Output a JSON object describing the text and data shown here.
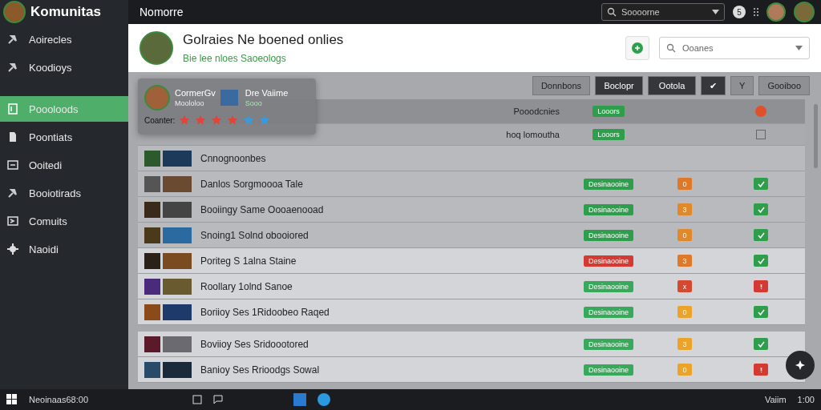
{
  "app": {
    "name": "Komunitas"
  },
  "sidebar": {
    "items": [
      {
        "label": "Aoirecles",
        "selected": false
      },
      {
        "label": "Koodioys",
        "selected": false
      },
      {
        "label": "Poooloods",
        "selected": true
      },
      {
        "label": "Poontiats",
        "selected": false
      },
      {
        "label": "Ooitedi",
        "selected": false
      },
      {
        "label": "Booiotirads",
        "selected": false
      },
      {
        "label": "Comuits",
        "selected": false
      },
      {
        "label": "Naoidi",
        "selected": false
      }
    ]
  },
  "topbar": {
    "title": "Nomorre",
    "search": {
      "placeholder": "Soooorne"
    },
    "badge": "5"
  },
  "header": {
    "title": "Golraies Ne boened onlies",
    "subtitle": "Bie lee nloes Saoeologs",
    "search": {
      "placeholder": "Ooanes"
    }
  },
  "toolbar": {
    "buttons": [
      {
        "label": "Donnbons",
        "kind": "text",
        "selected": false
      },
      {
        "label": "Boclopr",
        "kind": "text",
        "selected": true
      },
      {
        "label": "Ootola",
        "kind": "text",
        "selected": true
      },
      {
        "label": "✔",
        "kind": "text",
        "selected": true
      },
      {
        "label": "Y",
        "kind": "text",
        "selected": false
      },
      {
        "label": "Gooiboo",
        "kind": "text",
        "selected": false
      }
    ]
  },
  "popup": {
    "name": "CormerGv",
    "handle": "Moololoo",
    "game": "Dre Vaiime",
    "game_sub": "Sooo",
    "rating_label": "Coanter:",
    "stars": 4
  },
  "table": {
    "header_rows": [
      {
        "label": "Pooodcnies",
        "tag": "Looors",
        "kind": "dot"
      },
      {
        "label": "hoq lomoutha",
        "tag": "Looors",
        "kind": "square"
      }
    ],
    "groups": [
      [
        {
          "name": "Cnnognoonbes"
        },
        {
          "name": "Danlos Sorgmoooa Tale",
          "status": {
            "label": "Desinaooine",
            "color": "#2e9e4c"
          },
          "count": {
            "label": "0",
            "color": "#e0782a"
          },
          "ok": true
        },
        {
          "name": "Booiingy Same Oooaenooad",
          "status": {
            "label": "Desinaooine",
            "color": "#2e9e4c"
          },
          "count": {
            "label": "3",
            "color": "#e0882a"
          },
          "ok": true
        },
        {
          "name": "Snoing1 Solnd obooiored",
          "status": {
            "label": "Desinaooine",
            "color": "#2e9e4c"
          },
          "count": {
            "label": "0",
            "color": "#e0882a"
          },
          "ok": true
        },
        {
          "name": "Poriteg S 1alna Staine",
          "status": {
            "label": "Desinaooine",
            "color": "#d43a32"
          },
          "count": {
            "label": "3",
            "color": "#e0782a"
          },
          "ok": true
        },
        {
          "name": "Roollary 1olnd Sanoe",
          "status": {
            "label": "Desinaooine",
            "color": "#38a95a"
          },
          "count": {
            "label": "x",
            "color": "#d54a2e"
          },
          "ok": false
        },
        {
          "name": "Boriioy Ses 1Ridoobeo Raqed",
          "status": {
            "label": "Desinaooine",
            "color": "#38a95a"
          },
          "count": {
            "label": "0",
            "color": "#eda22a"
          },
          "ok": true
        }
      ],
      [
        {
          "name": "Boviioy Ses Sridoootored",
          "status": {
            "label": "Desinaooine",
            "color": "#38a95a"
          },
          "count": {
            "label": "3",
            "color": "#eda22a"
          },
          "ok": true
        },
        {
          "name": "Banioy Ses Rrioodgs Sowal",
          "status": {
            "label": "Desinaooine",
            "color": "#38a95a"
          },
          "count": {
            "label": "0",
            "color": "#eda22a"
          },
          "ok": false
        }
      ]
    ]
  },
  "taskbar": {
    "label": "Neoinaas68:00",
    "tray": "Vaiim",
    "clock": "1:00"
  }
}
